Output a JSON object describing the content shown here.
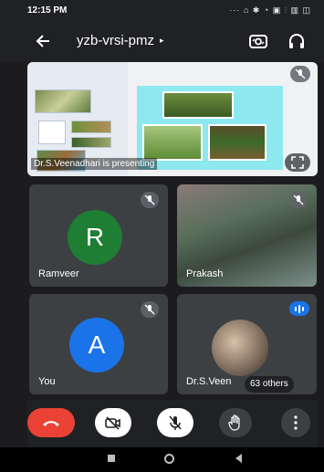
{
  "status_bar": {
    "time": "12:15 PM",
    "icons_text": "··· ⌂ ✱ ◔ ▣ ⫶ ▥ ◫"
  },
  "header": {
    "meeting_code": "yzb-vrsi-pmz",
    "caret": "▸"
  },
  "presentation": {
    "presenter_label": "Dr.S.Veenadhari is presenting"
  },
  "participants": [
    {
      "name": "Ramveer",
      "initial": "R",
      "avatar_color": "#1e7e34",
      "muted": true
    },
    {
      "name": "Prakash",
      "muted": true,
      "video": true
    },
    {
      "name": "You",
      "initial": "A",
      "avatar_color": "#1a73e8",
      "muted": true
    },
    {
      "name": "Dr.S.Veen",
      "speaking": true,
      "others_label": "63 others"
    }
  ],
  "controls": [
    {
      "name": "end-call",
      "icon": "end-call-icon",
      "color": "#ea4335"
    },
    {
      "name": "camera",
      "icon": "camera-off-icon"
    },
    {
      "name": "mic",
      "icon": "mic-off-icon"
    },
    {
      "name": "raise-hand",
      "icon": "hand-icon"
    },
    {
      "name": "more",
      "icon": "more-vertical-icon"
    }
  ]
}
